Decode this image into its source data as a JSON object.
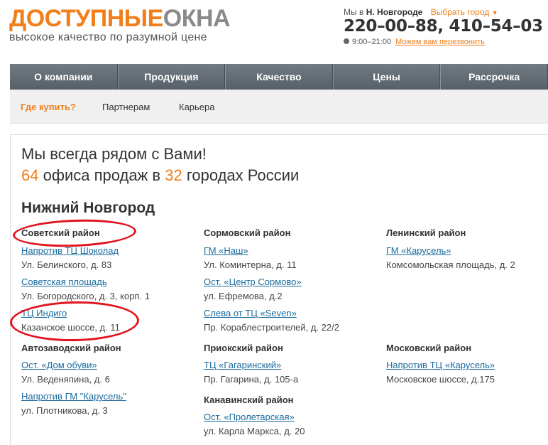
{
  "header": {
    "logo_part1": "ДОСТУПНЫЕ",
    "logo_part2": "ОКНА",
    "tagline": "высокое качество по разумной цене",
    "city_prefix": "Мы в",
    "city_name": "Н. Новгороде",
    "city_select_label": "Выбрать город",
    "phones": "220–00–88,  410–54–03",
    "hours": "9:00–21:00",
    "callback_label": "Можем вам перезвонить",
    "icons": {
      "clock": "clock-icon",
      "caret": "caret-down-icon"
    }
  },
  "main_nav": [
    "О компании",
    "Продукция",
    "Качество",
    "Цены",
    "Рассрочка"
  ],
  "sub_nav": [
    "Где купить?",
    "Партнерам",
    "Карьера"
  ],
  "content": {
    "intro_line1": "Мы всегда рядом с Вами!",
    "offices_count": "64",
    "offices_text": "офиса продаж в",
    "cities_count": "32",
    "cities_text": "городах России",
    "city_title": "Нижний Новгород"
  },
  "districts": [
    {
      "name": "Советский район",
      "shops": [
        {
          "name": "Напротив ТЦ Шоколад",
          "address": "Ул. Белинского, д. 83"
        },
        {
          "name": "Советская площадь",
          "address": "Ул. Богородского, д. 3, корп. 1"
        },
        {
          "name": "ТЦ Индиго",
          "address": "Казанское шоссе, д. 11"
        }
      ]
    },
    {
      "name": "Сормовский район",
      "shops": [
        {
          "name": "ГМ «Наш»",
          "address": "Ул. Коминтерна, д. 11"
        },
        {
          "name": "Ост. «Центр Сормово»",
          "address": "ул. Ефремова, д.2"
        },
        {
          "name": "Слева от ТЦ «Seven»",
          "address": "Пр. Кораблестроителей, д. 22/2"
        }
      ]
    },
    {
      "name": "Ленинский район",
      "shops": [
        {
          "name": "ГМ «Карусель»",
          "address": "Комсомольская площадь, д. 2"
        }
      ]
    },
    {
      "name": "Автозаводский район",
      "shops": [
        {
          "name": "Ост. «Дом обуви»",
          "address": "Ул. Веденяпина, д. 6"
        },
        {
          "name": "Напротив ГМ \"Карусель\"",
          "address": "ул. Плотникова, д. 3"
        }
      ]
    },
    {
      "name": "Приокский район",
      "shops": [
        {
          "name": "ТЦ «Гагаринский»",
          "address": "Пр. Гагарина, д. 105-а"
        }
      ]
    },
    {
      "name": "Канавинский район",
      "shops": [
        {
          "name": "Ост. «Пролетарская»",
          "address": "ул. Карла Маркса, д. 20"
        }
      ]
    },
    {
      "name": "Московский район",
      "shops": [
        {
          "name": "Напротив ТЦ «Карусель»",
          "address": "Московское шоссе, д.175"
        }
      ]
    }
  ],
  "colors": {
    "accent": "#f07f1b",
    "link": "#1a6b9c",
    "annotation": "#e0141e",
    "nav_bg": "#62696f"
  }
}
